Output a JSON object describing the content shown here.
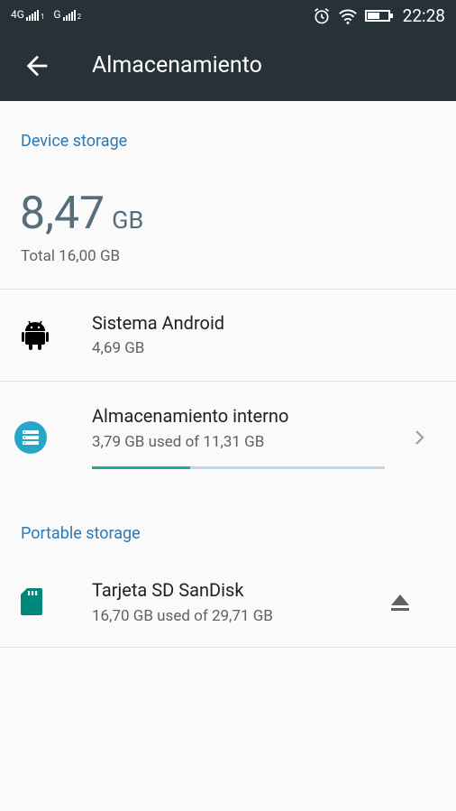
{
  "status_bar": {
    "network_1": "4G",
    "network_1_sim": "1",
    "network_2": "G",
    "network_2_sim": "2",
    "time": "22:28",
    "battery_level": 0.55,
    "icons": [
      "alarm-icon",
      "wifi-icon",
      "battery-icon"
    ]
  },
  "app_bar": {
    "title": "Almacenamiento",
    "back_icon": "arrow-back-icon"
  },
  "device_storage": {
    "header": "Device storage",
    "used_value": "8,47",
    "used_unit": "GB",
    "total_label": "Total 16,00 GB"
  },
  "items": [
    {
      "icon": "android-icon",
      "title": "Sistema Android",
      "subtitle": "4,69 GB"
    },
    {
      "icon": "storage-icon",
      "title": "Almacenamiento interno",
      "subtitle": "3,79 GB used of 11,31 GB",
      "used_fraction": 0.335,
      "action_icon": "chevron-right-icon"
    }
  ],
  "portable_storage": {
    "header": "Portable storage",
    "items": [
      {
        "icon": "sd-card-icon",
        "title": "Tarjeta SD SanDisk",
        "subtitle": "16,70 GB used of 29,71 GB",
        "action_icon": "eject-icon"
      }
    ]
  },
  "colors": {
    "app_bar": "#263238",
    "accent_header": "#2a7ab9",
    "progress_fill": "#26a69a",
    "progress_track": "#bfd6e6",
    "big_number": "#546e7a"
  }
}
